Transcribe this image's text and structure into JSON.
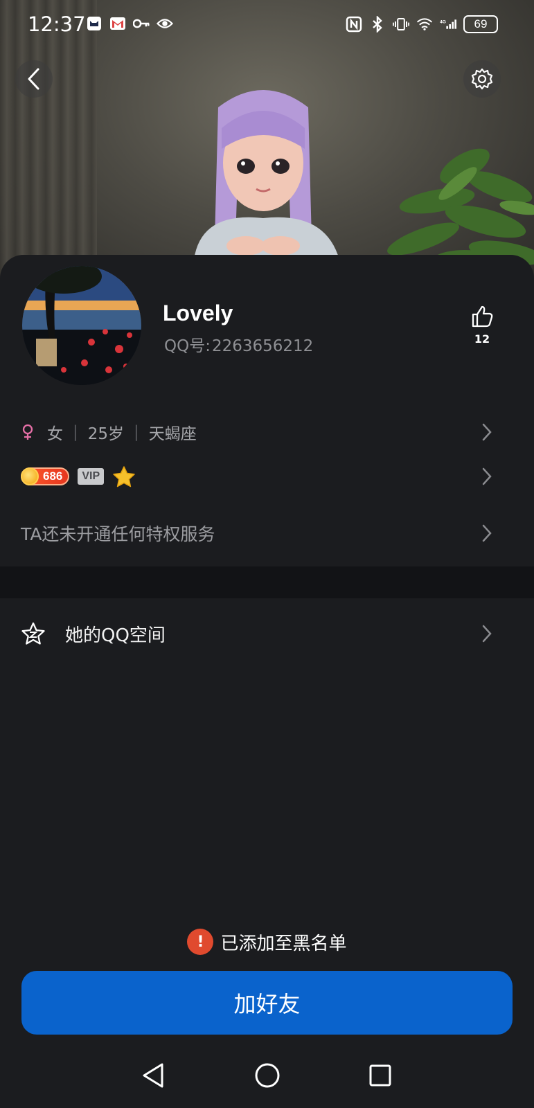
{
  "status_bar": {
    "time": "12:37",
    "left_icons": [
      "app-cat-icon",
      "gmail-icon",
      "key-icon",
      "eye-icon"
    ],
    "right_icons": [
      "nfc-icon",
      "bluetooth-icon",
      "vibrate-icon",
      "wifi-icon",
      "signal-4g-icon"
    ],
    "battery": "69"
  },
  "header": {
    "back_icon": "chevron-left-icon",
    "settings_icon": "gear-icon"
  },
  "profile": {
    "name": "Lovely",
    "qq_label": "QQ号:",
    "qq_number": "2263656212",
    "likes": "12"
  },
  "info": {
    "gender_icon": "female-icon",
    "gender": "女",
    "age": "25岁",
    "zodiac": "天蝎座"
  },
  "badges": {
    "coin_value": "686",
    "vip": "VIP",
    "star_icon": "star-icon"
  },
  "privilege": {
    "text": "TA还未开通任何特权服务"
  },
  "zone": {
    "label": "她的QQ空间",
    "icon": "qzone-star-icon"
  },
  "blacklist": {
    "text": "已添加至黑名单"
  },
  "actions": {
    "add_friend": "加好友"
  },
  "nav": {
    "back": "nav-back-icon",
    "home": "nav-home-icon",
    "recents": "nav-recents-icon"
  },
  "colors": {
    "background": "#1b1c1f",
    "primary_button": "#0a63cc",
    "warning": "#e04a2e",
    "gender_female": "#e56fa6"
  }
}
